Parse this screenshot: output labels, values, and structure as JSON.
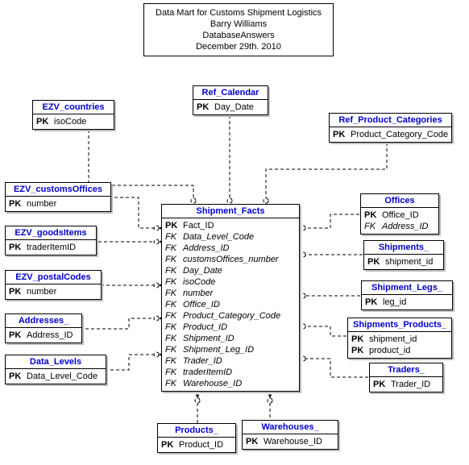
{
  "title": {
    "line1": "Data Mart for Customs Shipment Logistics",
    "line2": "Barry Williams",
    "line3": "DatabaseAnswers",
    "line4": "December 29th. 2010"
  },
  "entities": {
    "ref_calendar": {
      "name": "Ref_Calendar",
      "attrs": [
        {
          "key": "PK",
          "col": "Day_Date"
        }
      ]
    },
    "ezv_countries": {
      "name": "EZV_countries",
      "attrs": [
        {
          "key": "PK",
          "col": "isoCode"
        }
      ]
    },
    "ref_product_categories": {
      "name": "Ref_Product_Categories",
      "attrs": [
        {
          "key": "PK",
          "col": "Product_Category_Code"
        }
      ]
    },
    "ezv_customsoffices": {
      "name": "EZV_customsOffices",
      "attrs": [
        {
          "key": "PK",
          "col": "number"
        }
      ]
    },
    "ezv_goodsitems": {
      "name": "EZV_goodsItems",
      "attrs": [
        {
          "key": "PK",
          "col": "traderItemID"
        }
      ]
    },
    "ezv_postalcodes": {
      "name": "EZV_postalCodes",
      "attrs": [
        {
          "key": "PK",
          "col": "number"
        }
      ]
    },
    "addresses": {
      "name": "Addresses_",
      "attrs": [
        {
          "key": "PK",
          "col": "Address_ID"
        }
      ]
    },
    "data_levels": {
      "name": "Data_Levels",
      "attrs": [
        {
          "key": "PK",
          "col": "Data_Level_Code"
        }
      ]
    },
    "offices": {
      "name": "Offices",
      "attrs": [
        {
          "key": "PK",
          "col": "Office_ID"
        },
        {
          "key": "FK",
          "col": "Address_ID",
          "italic": true
        }
      ]
    },
    "shipments": {
      "name": "Shipments_",
      "attrs": [
        {
          "key": "PK",
          "col": "shipment_id"
        }
      ]
    },
    "shipment_legs": {
      "name": "Shipment_Legs_",
      "attrs": [
        {
          "key": "PK",
          "col": "leg_id"
        }
      ]
    },
    "shipments_products": {
      "name": "Shipments_Products_",
      "attrs": [
        {
          "key": "PK",
          "col": "shipment_id"
        },
        {
          "key": "PK",
          "col": "product_id"
        }
      ]
    },
    "traders": {
      "name": "Traders_",
      "attrs": [
        {
          "key": "PK",
          "col": "Trader_ID"
        }
      ]
    },
    "products": {
      "name": "Products_",
      "attrs": [
        {
          "key": "PK",
          "col": "Product_ID"
        }
      ]
    },
    "warehouses": {
      "name": "Warehouses_",
      "attrs": [
        {
          "key": "PK",
          "col": "Warehouse_ID"
        }
      ]
    },
    "shipment_facts": {
      "name": "Shipment_Facts",
      "attrs": [
        {
          "key": "PK",
          "col": "Fact_ID"
        },
        {
          "key": "FK",
          "col": "Data_Level_Code",
          "italic": true
        },
        {
          "key": "FK",
          "col": "Address_ID",
          "italic": true
        },
        {
          "key": "FK",
          "col": "customsOffices_number",
          "italic": true
        },
        {
          "key": "FK",
          "col": "Day_Date",
          "italic": true
        },
        {
          "key": "FK",
          "col": "isoCode",
          "italic": true
        },
        {
          "key": "FK",
          "col": "number",
          "italic": true
        },
        {
          "key": "FK",
          "col": "Office_ID",
          "italic": true
        },
        {
          "key": "FK",
          "col": "Product_Category_Code",
          "italic": true
        },
        {
          "key": "FK",
          "col": "Product_ID",
          "italic": true
        },
        {
          "key": "FK",
          "col": "Shipment_ID",
          "italic": true
        },
        {
          "key": "FK",
          "col": "Shipment_Leg_ID",
          "italic": true
        },
        {
          "key": "FK",
          "col": "Trader_ID",
          "italic": true
        },
        {
          "key": "FK",
          "col": "traderItemID",
          "italic": true
        },
        {
          "key": "FK",
          "col": "Warehouse_ID",
          "italic": true
        }
      ]
    }
  }
}
